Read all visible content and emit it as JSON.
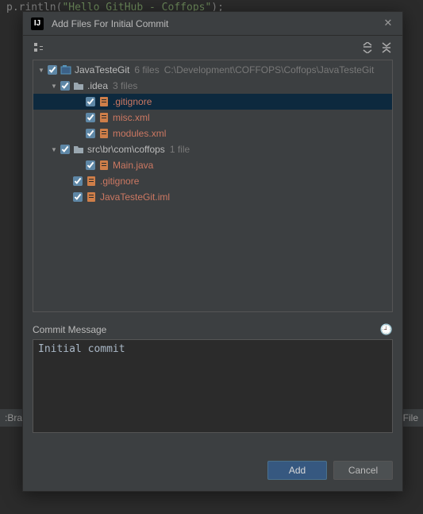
{
  "bg_code_prefix": "p.rintln(",
  "bg_code_str": "\"Hello GitHub - Coffops\"",
  "bg_code_suffix": ");",
  "bg_footer_left": ":Brai",
  "bg_footer_right": "m File",
  "dialog": {
    "title": "Add Files For Initial Commit",
    "commit_label": "Commit Message",
    "commit_message": "Initial commit",
    "add_button": "Add",
    "cancel_button": "Cancel"
  },
  "tree": [
    {
      "indent": 0,
      "arrow": "down",
      "checked": true,
      "icon": "module",
      "label": "JavaTesteGit",
      "labelClass": "light",
      "meta": "6 files",
      "meta2": "C:\\Development\\COFFOPS\\Coffops\\JavaTesteGit",
      "selected": false
    },
    {
      "indent": 1,
      "arrow": "down",
      "checked": true,
      "icon": "folder",
      "label": ".idea",
      "labelClass": "light",
      "meta": "3 files",
      "selected": false
    },
    {
      "indent": 3,
      "arrow": "",
      "checked": true,
      "icon": "file",
      "label": ".gitignore",
      "labelClass": "red",
      "selected": true
    },
    {
      "indent": 3,
      "arrow": "",
      "checked": true,
      "icon": "file",
      "label": "misc.xml",
      "labelClass": "red",
      "selected": false
    },
    {
      "indent": 3,
      "arrow": "",
      "checked": true,
      "icon": "file",
      "label": "modules.xml",
      "labelClass": "red",
      "selected": false
    },
    {
      "indent": 1,
      "arrow": "down",
      "checked": true,
      "icon": "folder",
      "label": "src\\br\\com\\coffops",
      "labelClass": "light",
      "meta": "1 file",
      "selected": false
    },
    {
      "indent": 3,
      "arrow": "",
      "checked": true,
      "icon": "file",
      "label": "Main.java",
      "labelClass": "red",
      "selected": false
    },
    {
      "indent": 2,
      "arrow": "",
      "checked": true,
      "icon": "file",
      "label": ".gitignore",
      "labelClass": "red",
      "selected": false
    },
    {
      "indent": 2,
      "arrow": "",
      "checked": true,
      "icon": "file",
      "label": "JavaTesteGit.iml",
      "labelClass": "red",
      "selected": false
    }
  ]
}
